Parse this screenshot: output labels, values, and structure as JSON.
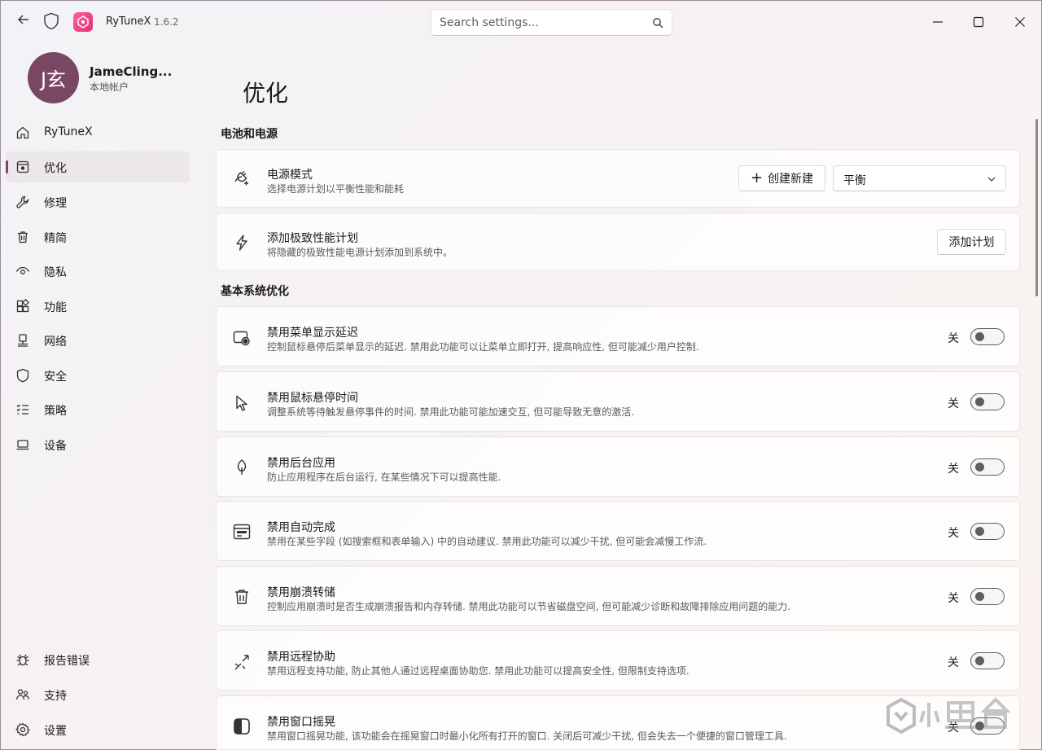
{
  "app": {
    "name": "RyTuneX",
    "version": "1.6.2"
  },
  "search": {
    "placeholder": "Search settings..."
  },
  "user": {
    "initials": "J玄",
    "name": "JameCling...",
    "account_type": "本地帐户"
  },
  "sidebar": {
    "items": [
      {
        "label": "RyTuneX",
        "icon": "home-icon"
      },
      {
        "label": "优化",
        "icon": "optimize-icon"
      },
      {
        "label": "修理",
        "icon": "wrench-icon"
      },
      {
        "label": "精简",
        "icon": "trash-icon"
      },
      {
        "label": "隐私",
        "icon": "eye-icon"
      },
      {
        "label": "功能",
        "icon": "apps-icon"
      },
      {
        "label": "网络",
        "icon": "network-icon"
      },
      {
        "label": "安全",
        "icon": "shield-icon"
      },
      {
        "label": "策略",
        "icon": "list-icon"
      },
      {
        "label": "设备",
        "icon": "laptop-icon"
      }
    ],
    "footer": [
      {
        "label": "报告错误",
        "icon": "bug-icon"
      },
      {
        "label": "支持",
        "icon": "people-icon"
      },
      {
        "label": "设置",
        "icon": "gear-icon"
      }
    ],
    "active_index": 1
  },
  "main": {
    "title": "优化",
    "sections": [
      {
        "title": "电池和电源"
      },
      {
        "title": "基本系统优化"
      }
    ],
    "power_mode": {
      "title": "电源模式",
      "desc": "选择电源计划以平衡性能和能耗",
      "create_label": "创建新建",
      "selected": "平衡"
    },
    "ultimate_plan": {
      "title": "添加极致性能计划",
      "desc": "将隐藏的极致性能电源计划添加到系统中。",
      "button_label": "添加计划"
    },
    "toggles": [
      {
        "title": "禁用菜单显示延迟",
        "desc": "控制鼠标悬停后菜单显示的延迟. 禁用此功能可以让菜单立即打开, 提高响应性, 但可能减少用户控制.",
        "state": "关",
        "icon": "menu-clock-icon"
      },
      {
        "title": "禁用鼠标悬停时间",
        "desc": "调整系统等待触发悬停事件的时间. 禁用此功能可能加速交互, 但可能导致无意的激活.",
        "state": "关",
        "icon": "cursor-icon"
      },
      {
        "title": "禁用后台应用",
        "desc": "防止应用程序在后台运行, 在某些情况下可以提高性能.",
        "state": "关",
        "icon": "leaf-icon"
      },
      {
        "title": "禁用自动完成",
        "desc": "禁用在某些字段 (如搜索框和表单输入) 中的自动建议. 禁用此功能可以减少干扰, 但可能会减慢工作流.",
        "state": "关",
        "icon": "form-icon"
      },
      {
        "title": "禁用崩溃转储",
        "desc": "控制应用崩溃时是否生成崩溃报告和内存转储. 禁用此功能可以节省磁盘空间, 但可能减少诊断和故障排除应用问题的能力.",
        "state": "关",
        "icon": "trash-icon"
      },
      {
        "title": "禁用远程协助",
        "desc": "禁用远程支持功能, 防止其他人通过远程桌面协助您. 禁用此功能可以提高安全性, 但限制支持选项.",
        "state": "关",
        "icon": "remote-icon"
      },
      {
        "title": "禁用窗口摇晃",
        "desc": "禁用窗口摇晃功能, 该功能会在摇晃窗口时最小化所有打开的窗口. 关闭后可减少干扰, 但会失去一个便捷的窗口管理工具.",
        "state": "关",
        "icon": "contrast-icon"
      }
    ]
  }
}
